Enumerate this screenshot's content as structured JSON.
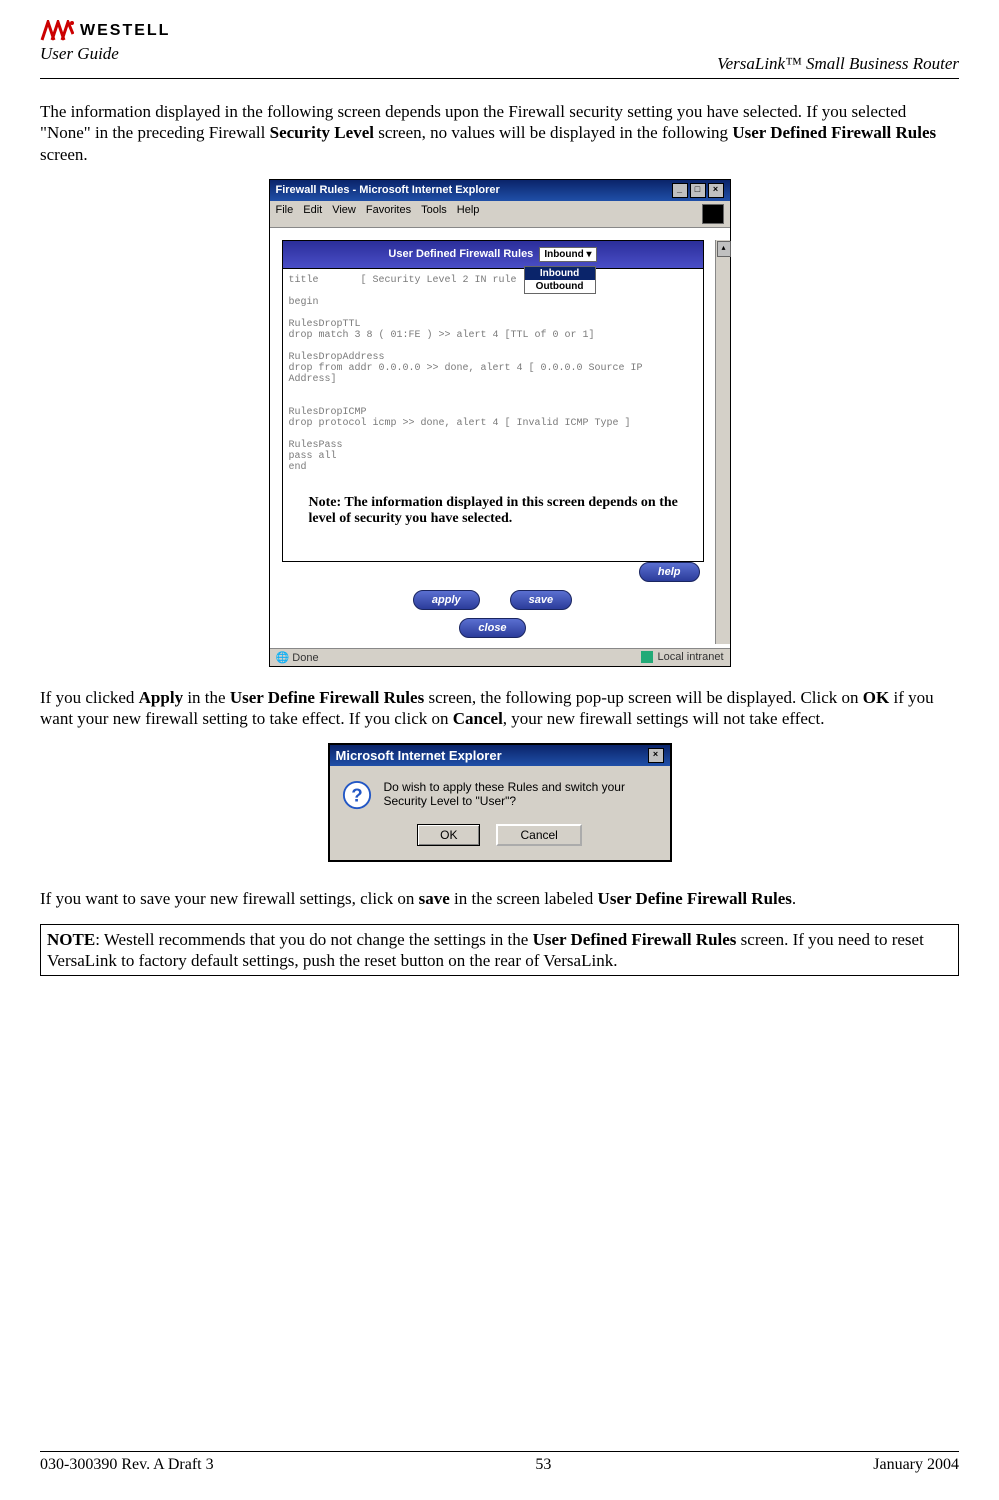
{
  "header": {
    "brand": "WESTELL",
    "left_subtitle": "User Guide",
    "right_title": "VersaLink™  Small Business Router"
  },
  "para1_pre": "The information displayed in the following screen depends upon the Firewall security setting you have selected. If you selected \"None\" in the preceding Firewall ",
  "para1_b1": "Security Level",
  "para1_mid": " screen, no values will be displayed in the following ",
  "para1_b2": "User Defined Firewall Rules",
  "para1_post": " screen.",
  "shot1": {
    "window_title": "Firewall Rules - Microsoft Internet Explorer",
    "menus": [
      "File",
      "Edit",
      "View",
      "Favorites",
      "Tools",
      "Help"
    ],
    "panel_title": "User Defined Firewall Rules",
    "direction_selected": "Inbound",
    "direction_options": [
      "Inbound",
      "Outbound"
    ],
    "rules_text": "title       [ Security Level 2 IN rule\n\nbegin\n\nRulesDropTTL\ndrop match 3 8 ( 01:FE ) >> alert 4 [TTL of 0 or 1]\n\nRulesDropAddress\ndrop from addr 0.0.0.0 >> done, alert 4 [ 0.0.0.0 Source IP\nAddress]\n\n\nRulesDropICMP\ndrop protocol icmp >> done, alert 4 [ Invalid ICMP Type ]\n\nRulesPass\npass all\nend",
    "note_overlay": "Note: The information displayed in this screen depends on the level of security you have selected.",
    "buttons": {
      "apply": "Apply",
      "save": "save",
      "close": "close",
      "help": "help"
    },
    "status_left": "Done",
    "status_right": "Local intranet"
  },
  "para2_pre": "If you clicked ",
  "para2_b1": "Apply",
  "para2_mid1": " in the ",
  "para2_b2": "User Define Firewall Rules",
  "para2_mid2": " screen, the following pop-up screen will be displayed. Click on ",
  "para2_b3": "OK",
  "para2_mid3": " if you want your new firewall setting to take effect. If you click on ",
  "para2_b4": "Cancel",
  "para2_post": ", your new firewall settings will not take effect.",
  "shot2": {
    "title": "Microsoft Internet Explorer",
    "message": "Do wish to apply these Rules and switch your Security Level to \"User\"?",
    "ok": "OK",
    "cancel": "Cancel"
  },
  "para3_pre": "If you want to save your new firewall settings, click on ",
  "para3_b1": "save",
  "para3_mid": " in the screen labeled ",
  "para3_b2": "User Define Firewall Rules",
  "para3_post": ".",
  "notebox_pre": "NOTE",
  "notebox_mid1": ": Westell recommends that you do not change the settings in the ",
  "notebox_b1": "User Defined Firewall Rules",
  "notebox_post": " screen. If you need to reset VersaLink to factory default settings, push the reset button on the rear of VersaLink.",
  "footer": {
    "left": "030-300390 Rev. A Draft 3",
    "center": "53",
    "right": "January 2004"
  }
}
